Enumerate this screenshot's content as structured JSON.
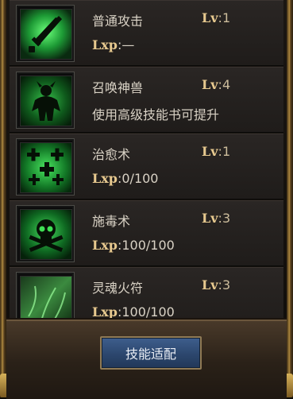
{
  "skills": [
    {
      "name": "普通攻击",
      "lv_label": "Lv",
      "level": ":1",
      "detail_label": "Lxp",
      "detail_value": ":—",
      "icon": "sword-icon"
    },
    {
      "name": "召唤神兽",
      "lv_label": "Lv",
      "level": ":4",
      "description": "使用高级技能书可提升",
      "icon": "beast-icon"
    },
    {
      "name": "治愈术",
      "lv_label": "Lv",
      "level": ":1",
      "detail_label": "Lxp",
      "detail_value": ":0/100",
      "icon": "heal-icon"
    },
    {
      "name": "施毒术",
      "lv_label": "Lv",
      "level": ":3",
      "detail_label": "Lxp",
      "detail_value": ":100/100",
      "icon": "poison-skull-icon"
    },
    {
      "name": "灵魂火符",
      "lv_label": "Lv",
      "level": ":3",
      "detail_label": "Lxp",
      "detail_value": ":100/100",
      "icon": "soul-talisman-icon"
    }
  ],
  "button": {
    "label": "技能适配"
  },
  "colors": {
    "icon_green": "#3cff5a",
    "button_blue": "#2c476e",
    "frame_gold": "#b08a40"
  }
}
